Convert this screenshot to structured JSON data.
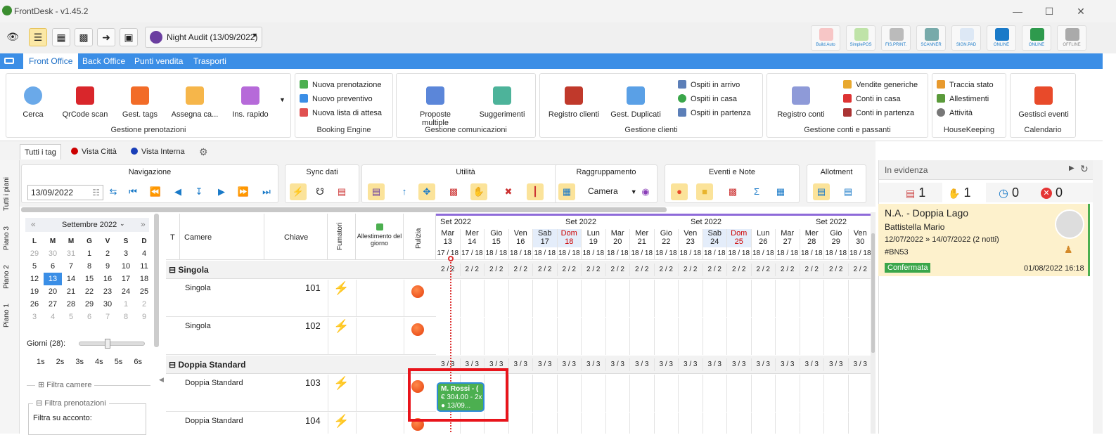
{
  "app": {
    "title": "FrontDesk - v1.45.2"
  },
  "toolbar": {
    "night_audit": "Night Audit (13/09/2022)",
    "right_buttons": [
      "Build.Auto",
      "SimplePOS",
      "FIS.PRINT.",
      "SCANNER",
      "SIGN.PAD",
      "ONLINE",
      "ONLINE",
      "OFFLINE"
    ]
  },
  "menu": {
    "tabs": [
      "Front Office",
      "Back Office",
      "Punti vendita",
      "Trasporti"
    ]
  },
  "ribbon": {
    "prenotazioni": {
      "label": "Gestione prenotazioni",
      "buttons": [
        "Cerca",
        "QrCode scan",
        "Gest. tags",
        "Assegna ca...",
        "Ins. rapido"
      ]
    },
    "booking": {
      "label": "Booking Engine",
      "items": [
        "Nuova prenotazione",
        "Nuovo preventivo",
        "Nuova lista di attesa"
      ]
    },
    "comunicazioni": {
      "label": "Gestione comunicazioni",
      "buttons": [
        "Proposte multiple",
        "Suggerimenti"
      ]
    },
    "clienti": {
      "label": "Gestione clienti",
      "buttons": [
        "Registro clienti",
        "Gest. Duplicati"
      ],
      "items": [
        "Ospiti in arrivo",
        "Ospiti in casa",
        "Ospiti in partenza"
      ]
    },
    "conti": {
      "label": "Gestione conti e passanti",
      "buttons": [
        "Registro conti"
      ],
      "items": [
        "Vendite generiche",
        "Conti in casa",
        "Conti in partenza"
      ]
    },
    "housekeeping": {
      "label": "HouseKeeping",
      "items": [
        "Traccia stato",
        "Allestimenti",
        "Attività"
      ]
    },
    "calendario": {
      "label": "Calendario",
      "buttons": [
        "Gestisci eventi"
      ]
    }
  },
  "tags": [
    "Tutti i tag",
    "Vista Città",
    "Vista Interna"
  ],
  "floors": [
    "Tutti i piani",
    "Piano 3",
    "Piano 2",
    "Piano 1"
  ],
  "nav": {
    "navigazione": "Navigazione",
    "date": "13/09/2022",
    "sync": "Sync dati",
    "utilita": "Utilità",
    "raggruppamento": "Raggruppamento",
    "group_value": "Camera",
    "eventi": "Eventi e Note",
    "allotment": "Allotment"
  },
  "calendar": {
    "month": "Settembre 2022",
    "weekdays": [
      "L",
      "M",
      "M",
      "G",
      "V",
      "S",
      "D"
    ],
    "weeks": [
      [
        "29",
        "30",
        "31",
        "1",
        "2",
        "3",
        "4"
      ],
      [
        "5",
        "6",
        "7",
        "8",
        "9",
        "10",
        "11"
      ],
      [
        "12",
        "13",
        "14",
        "15",
        "16",
        "17",
        "18"
      ],
      [
        "19",
        "20",
        "21",
        "22",
        "23",
        "24",
        "25"
      ],
      [
        "26",
        "27",
        "28",
        "29",
        "30",
        "1",
        "2"
      ],
      [
        "3",
        "4",
        "5",
        "6",
        "7",
        "8",
        "9"
      ]
    ],
    "giorni": "Giorni (28):",
    "spans": [
      "1s",
      "2s",
      "3s",
      "4s",
      "5s",
      "6s"
    ],
    "filtra_camere": "Filtra camere",
    "filtra_pren": "Filtra prenotazioni",
    "filtra_acconto": "Filtra su acconto:"
  },
  "grid": {
    "headers": {
      "t": "T",
      "camere": "Camere",
      "chiave": "Chiave",
      "fumatori": "Fumatori",
      "allestimento": "Allestimento del giorno",
      "pulizia": "Pulizia"
    },
    "months": [
      "Set 2022",
      "Set 2022",
      "Set 2022",
      "Set 2022"
    ],
    "days": [
      [
        "Mar",
        "13"
      ],
      [
        "Mer",
        "14"
      ],
      [
        "Gio",
        "15"
      ],
      [
        "Ven",
        "16"
      ],
      [
        "Sab",
        "17"
      ],
      [
        "Dom",
        "18"
      ],
      [
        "Lun",
        "19"
      ],
      [
        "Mar",
        "20"
      ],
      [
        "Mer",
        "21"
      ],
      [
        "Gio",
        "22"
      ],
      [
        "Ven",
        "23"
      ],
      [
        "Sab",
        "24"
      ],
      [
        "Dom",
        "25"
      ],
      [
        "Lun",
        "26"
      ],
      [
        "Mar",
        "27"
      ],
      [
        "Mer",
        "28"
      ],
      [
        "Gio",
        "29"
      ],
      [
        "Ven",
        "30"
      ]
    ],
    "occ": [
      "17 / 18",
      "17 / 18",
      "18 / 18",
      "18 / 18",
      "18 / 18",
      "18 / 18",
      "18 / 18",
      "18 / 18",
      "18 / 18",
      "18 / 18",
      "18 / 18",
      "18 / 18",
      "18 / 18",
      "18 / 18",
      "18 / 18",
      "18 / 18",
      "18 / 18",
      "18 / 18"
    ],
    "sections": [
      {
        "name": "Singola",
        "counts": [
          "2 / 2",
          "2 / 2",
          "2 / 2",
          "2 / 2",
          "2 / 2",
          "2 / 2",
          "2 / 2",
          "2 / 2",
          "2 / 2",
          "2 / 2",
          "2 / 2",
          "2 / 2",
          "2 / 2",
          "2 / 2",
          "2 / 2",
          "2 / 2",
          "2 / 2",
          "2 / 2"
        ],
        "rooms": [
          {
            "name": "Singola",
            "key": "101"
          },
          {
            "name": "Singola",
            "key": "102"
          }
        ]
      },
      {
        "name": "Doppia Standard",
        "counts": [
          "3 / 3",
          "3 / 3",
          "3 / 3",
          "3 / 3",
          "3 / 3",
          "3 / 3",
          "3 / 3",
          "3 / 3",
          "3 / 3",
          "3 / 3",
          "3 / 3",
          "3 / 3",
          "3 / 3",
          "3 / 3",
          "3 / 3",
          "3 / 3",
          "3 / 3",
          "3 / 3"
        ],
        "rooms": [
          {
            "name": "Doppia Standard",
            "key": "103"
          },
          {
            "name": "Doppia Standard",
            "key": "104"
          }
        ]
      }
    ],
    "booking": {
      "name": "M. Rossi - (",
      "price": "€ 304.00 - 2x",
      "date": "13/09..."
    }
  },
  "evidenza": {
    "title": "In evidenza",
    "counts": [
      "1",
      "1",
      "0",
      "0"
    ],
    "card": {
      "title": "N.A. - Doppia Lago",
      "guest": "Battistella Mario",
      "dates": "12/07/2022 » 14/07/2022 (2 notti)",
      "code": "#BN53",
      "status": "Confermata",
      "timestamp": "01/08/2022 16:18"
    }
  }
}
